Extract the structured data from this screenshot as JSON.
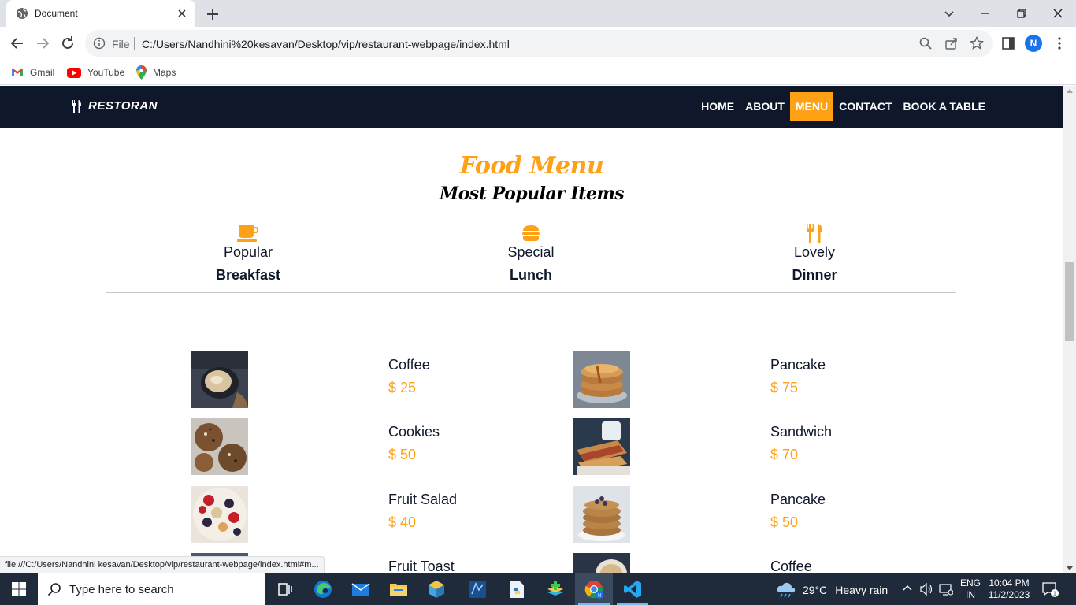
{
  "browser": {
    "tab_title": "Document",
    "file_label": "File",
    "url": "C:/Users/Nandhini%20kesavan/Desktop/vip/restaurant-webpage/index.html",
    "profile_initial": "N",
    "bookmarks": [
      "Gmail",
      "YouTube",
      "Maps"
    ],
    "status_url": "file:///C:/Users/Nandhini kesavan/Desktop/vip/restaurant-webpage/index.html#m..."
  },
  "site": {
    "brand": "RESTORAN",
    "nav": [
      {
        "label": "HOME",
        "active": false
      },
      {
        "label": "ABOUT",
        "active": false
      },
      {
        "label": "MENU",
        "active": true
      },
      {
        "label": "CONTACT",
        "active": false
      },
      {
        "label": "BOOK A TABLE",
        "active": false
      }
    ],
    "accent_color": "#fea116",
    "nav_bg_color": "#0f172b",
    "menu_title": "Food Menu",
    "menu_subtitle": "Most Popular Items",
    "categories": [
      {
        "small": "Popular",
        "big": "Breakfast",
        "icon": "coffee-cup-icon"
      },
      {
        "small": "Special",
        "big": "Lunch",
        "icon": "hamburger-icon"
      },
      {
        "small": "Lovely",
        "big": "Dinner",
        "icon": "utensils-icon"
      }
    ],
    "items_left": [
      {
        "name": "Coffee",
        "price": "$ 25",
        "image": "coffee-image"
      },
      {
        "name": "Cookies",
        "price": "$ 50",
        "image": "cookies-image"
      },
      {
        "name": "Fruit Salad",
        "price": "$ 40",
        "image": "fruit-salad-image"
      },
      {
        "name": "Fruit Toast",
        "price": "",
        "image": "fruit-toast-image"
      }
    ],
    "items_right": [
      {
        "name": "Pancake",
        "price": "$ 75",
        "image": "pancake-image"
      },
      {
        "name": "Sandwich",
        "price": "$ 70",
        "image": "sandwich-image"
      },
      {
        "name": "Pancake",
        "price": "$ 50",
        "image": "pancake-image"
      },
      {
        "name": "Coffee",
        "price": "",
        "image": "coffee-image"
      }
    ]
  },
  "taskbar": {
    "search_placeholder": "Type here to search",
    "weather_temp": "29°C",
    "weather_desc": "Heavy rain",
    "lang_line1": "ENG",
    "lang_line2": "IN",
    "time": "10:04 PM",
    "date": "11/2/2023",
    "notification_count": "1"
  }
}
